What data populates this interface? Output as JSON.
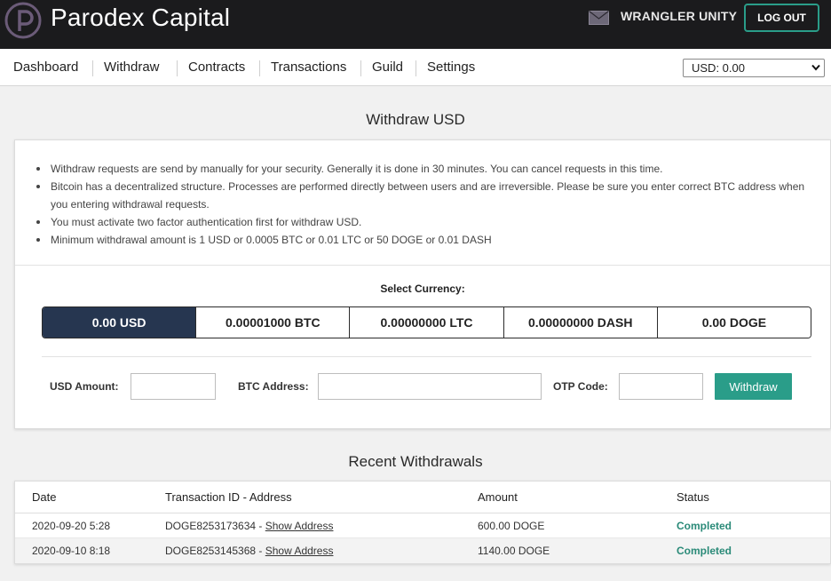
{
  "header": {
    "brand": "Parodex Capital",
    "logo_icon": "parodex-logo-icon",
    "mail_icon": "envelope-icon",
    "username": "WRANGLER UNITY",
    "logout_label": "LOG OUT"
  },
  "nav": {
    "items": [
      "Dashboard",
      "Withdraw",
      "Contracts",
      "Transactions",
      "Guild",
      "Settings"
    ],
    "currency_select": "USD: 0.00"
  },
  "withdraw": {
    "title": "Withdraw USD",
    "notes": [
      "Withdraw requests are send by manually for your security. Generally it is done in 30 minutes. You can cancel requests in this time.",
      "Bitcoin has a decentralized structure. Processes are performed directly between users and are irreversible. Please be sure you enter correct BTC address when you entering withdrawal requests.",
      "You must activate two factor authentication first for withdraw USD.",
      "Minimum withdrawal amount is 1 USD or 0.0005 BTC or 0.01 LTC or 50 DOGE or 0.01 DASH"
    ],
    "select_currency_label": "Select Currency:",
    "currencies": [
      "0.00 USD",
      "0.00001000 BTC",
      "0.00000000 LTC",
      "0.00000000 DASH",
      "0.00 DOGE"
    ],
    "active_currency": "0.00 USD",
    "usd_amount_label": "USD Amount:",
    "usd_amount_value": "",
    "btc_address_label": "BTC Address:",
    "btc_address_value": "",
    "otp_code_label": "OTP Code:",
    "otp_code_value": "",
    "withdraw_label": "Withdraw"
  },
  "recent": {
    "title": "Recent Withdrawals",
    "columns": [
      "Date",
      "Transaction ID - Address",
      "Amount",
      "Status"
    ],
    "rows": [
      {
        "date": "2020-09-20 5:28",
        "txid": "DOGE8253173634 - ",
        "link": "Show Address",
        "amount": "600.00 DOGE",
        "status": "Completed"
      },
      {
        "date": "2020-09-10 8:18",
        "txid": "DOGE8253145368 - ",
        "link": "Show Address",
        "amount": "1140.00 DOGE",
        "status": "Completed"
      }
    ]
  },
  "colors": {
    "header_bg": "#1b1b1d",
    "accent": "#2a9d89",
    "active_currency_bg": "#263650",
    "status_completed": "#2a8a78"
  }
}
